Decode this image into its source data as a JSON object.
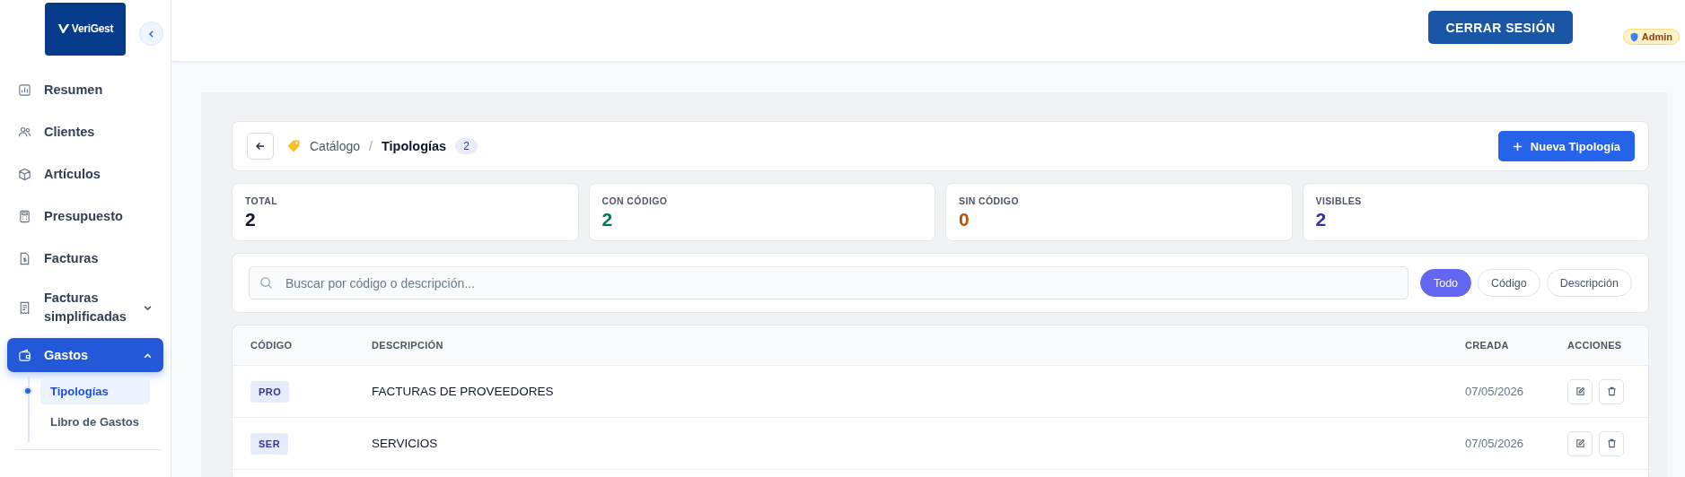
{
  "sidebar": {
    "logo": "VeriGest",
    "items": [
      {
        "label": "Resumen",
        "kind": "link",
        "selected": false
      },
      {
        "label": "Clientes",
        "kind": "link",
        "selected": false
      },
      {
        "label": "Artículos",
        "kind": "link",
        "selected": false
      },
      {
        "label": "Presupuesto",
        "kind": "link",
        "selected": false
      },
      {
        "label": "Facturas",
        "kind": "link",
        "selected": false
      },
      {
        "label": "Facturas simplificadas",
        "kind": "group",
        "selected": false,
        "expanded": false
      },
      {
        "label": "Gastos",
        "kind": "group",
        "selected": true,
        "expanded": true,
        "children": [
          {
            "label": "Tipologías",
            "selected": true
          },
          {
            "label": "Libro de Gastos",
            "selected": false
          }
        ]
      }
    ]
  },
  "header": {
    "logout": "CERRAR SESIÓN",
    "role": "Admin"
  },
  "breadcrumb": {
    "parent": "Catálogo",
    "separator": "/",
    "current": "Tipologías",
    "count": "2",
    "new_button": "Nueva Tipología"
  },
  "stats": [
    {
      "label": "TOTAL",
      "value": "2",
      "color": "#0f172a"
    },
    {
      "label": "CON CÓDIGO",
      "value": "2",
      "color": "#047857"
    },
    {
      "label": "SIN CÓDIGO",
      "value": "0",
      "color": "#b45309"
    },
    {
      "label": "VISIBLES",
      "value": "2",
      "color": "#3730a3"
    }
  ],
  "search": {
    "placeholder": "Buscar por código o descripción..."
  },
  "filters": [
    {
      "label": "Todo",
      "selected": true
    },
    {
      "label": "Código",
      "selected": false
    },
    {
      "label": "Descripción",
      "selected": false
    }
  ],
  "table": {
    "columns": [
      "CÓDIGO",
      "DESCRIPCIÓN",
      "CREADA",
      "ACCIONES"
    ],
    "rows": [
      {
        "code": "PRO",
        "description": "FACTURAS DE PROVEEDORES",
        "created": "07/05/2026"
      },
      {
        "code": "SER",
        "description": "SERVICIOS",
        "created": "07/05/2026"
      }
    ]
  }
}
